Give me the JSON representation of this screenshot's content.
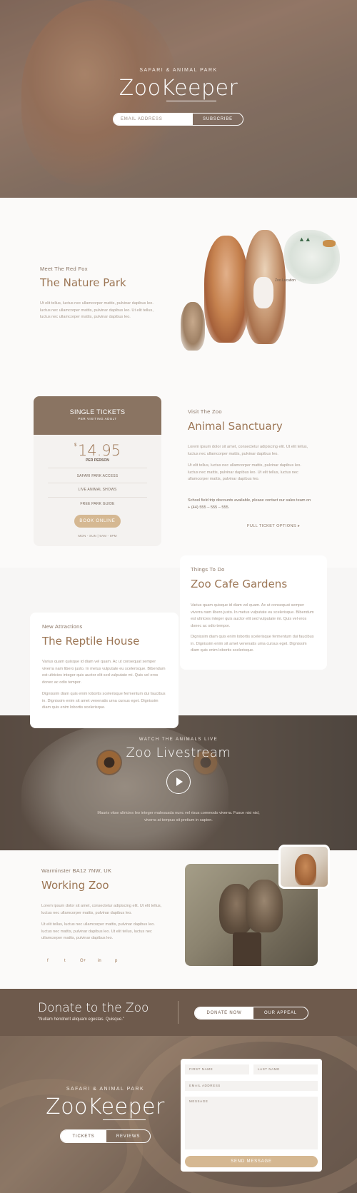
{
  "hero": {
    "kicker": "SAFARI & ANIMAL PARK",
    "logo": "ZooKeeper",
    "email_placeholder": "EMAIL ADDRESS",
    "subscribe_label": "SUBSCRIBE"
  },
  "nature": {
    "eyebrow": "Meet The Red Fox",
    "title": "The Nature Park",
    "body": "Ut elit tellus, luctus nec ullamcorper mattis, pulvinar dapibus leo. luctus nec ullamcorper mattis, pulvinar dapibus leo. Ut elit tellus, luctus nec ullamcorper mattis, pulvinar dapibus leo.",
    "map_label": "Zoo Location"
  },
  "ticket": {
    "title": "SINGLE TICKETS",
    "subtitle": "PER VISITING ADULT",
    "currency": "$",
    "price": "14.95",
    "per": "PER PERSON",
    "features": [
      "SAFARI PARK ACCESS",
      "LIVE ANIMAL SHOWS",
      "FREE PARK GUIDE"
    ],
    "book_label": "BOOK ONLINE",
    "hours": "MON - SUN | 9AM - 8PM"
  },
  "sanctuary": {
    "eyebrow": "Visit The Zoo",
    "title": "Animal Sanctuary",
    "p1": "Lorem ipsum dolor sit amet, consectetur adipiscing elit. Ut elit tellus, luctus nec ullamcorper mattis, pulvinar dapibus leo.",
    "p2": "Ut elit tellus, luctus nec ullamcorper mattis, pulvinar dapibus leo. luctus nec mattis, pulvinar dapibus leo. Ut elit tellus, luctus nec ullamcorper mattis, pulvinar dapibus leo.",
    "p3": "School field trip discounts available, please contact our sales team on + (44) 555 – 555 – 555.",
    "link": "FULL TICKET OPTIONS ▸"
  },
  "cafe": {
    "eyebrow": "Things To Do",
    "title": "Zoo Cafe Gardens",
    "p1": "Varius quam quisque id diam vel quam. Ac ut consequat semper viverra nam libero justo. In metus vulputate eu scelerisque. Bibendum est ultricies integer quis auctor elit sed vulputate mi. Quis vel eros donec ac odio tempor.",
    "p2": "Dignissim diam quis enim lobortis scelerisque fermentum dui faucibus in. Dignissim enim sit amet venenatis urna cursus eget. Dignissim diam quis enim lobortis scelerisque."
  },
  "reptile": {
    "eyebrow": "New Attractions",
    "title": "The Reptile House",
    "p1": "Varius quam quisque id diam vel quam. Ac ut consequat semper viverra nam libero justo. In metus vulputate eu scelerisque. Bibendum est ultricies integer quis auctor elit sed vulputate mi. Quis vel eros donec ac odio tempor.",
    "p2": "Dignissim diam quis enim lobortis scelerisque fermentum dui faucibus in. Dignissim enim sit amet venenatis urna cursus eget. Dignissim diam quis enim lobortis scelerisque."
  },
  "live": {
    "kicker": "WATCH THE ANIMALS LIVE",
    "title": "Zoo Livestream",
    "body": "Mauris vitae ultricies leo integer malesuada nunc vel risus commodo viverra. Fusce nisi nisl, viverra at tempus sit pretium in sapien."
  },
  "working": {
    "eyebrow": "Warminster BA12 7NW, UK",
    "title": "Working Zoo",
    "p1": "Lorem ipsum dolor sit amet, consectetur adipiscing elit. Ut elit tellus, luctus nec ullamcorper mattis, pulvinar dapibus leo.",
    "p2": "Ut elit tellus, luctus nec ullamcorper mattis, pulvinar dapibus leo. luctus nec mattis, pulvinar dapibus leo. Ut elit tellus, luctus nec ullamcorper mattis, pulvinar dapibus leo.",
    "socials": [
      "f",
      "t",
      "G+",
      "in",
      "p"
    ]
  },
  "donate": {
    "title": "Donate to the Zoo",
    "quote": "\"Nullam hendrerit aliquam egestas. Quisque.\"",
    "donate_label": "DONATE NOW",
    "appeal_label": "OUR APPEAL"
  },
  "footer": {
    "kicker": "SAFARI & ANIMAL PARK",
    "logo": "ZooKeeper",
    "tickets_label": "TICKETS",
    "reviews_label": "REVIEWS",
    "first_name": "FIRST NAME",
    "last_name": "LAST NAME",
    "email": "EMAIL ADDRESS",
    "message": "MESSAGE",
    "send_label": "SEND MESSAGE"
  },
  "colors": {
    "brand_brown": "#8a7462",
    "accent_tan": "#d5b892",
    "heading": "#9c7655",
    "donate_bg": "#6e5a4c"
  }
}
